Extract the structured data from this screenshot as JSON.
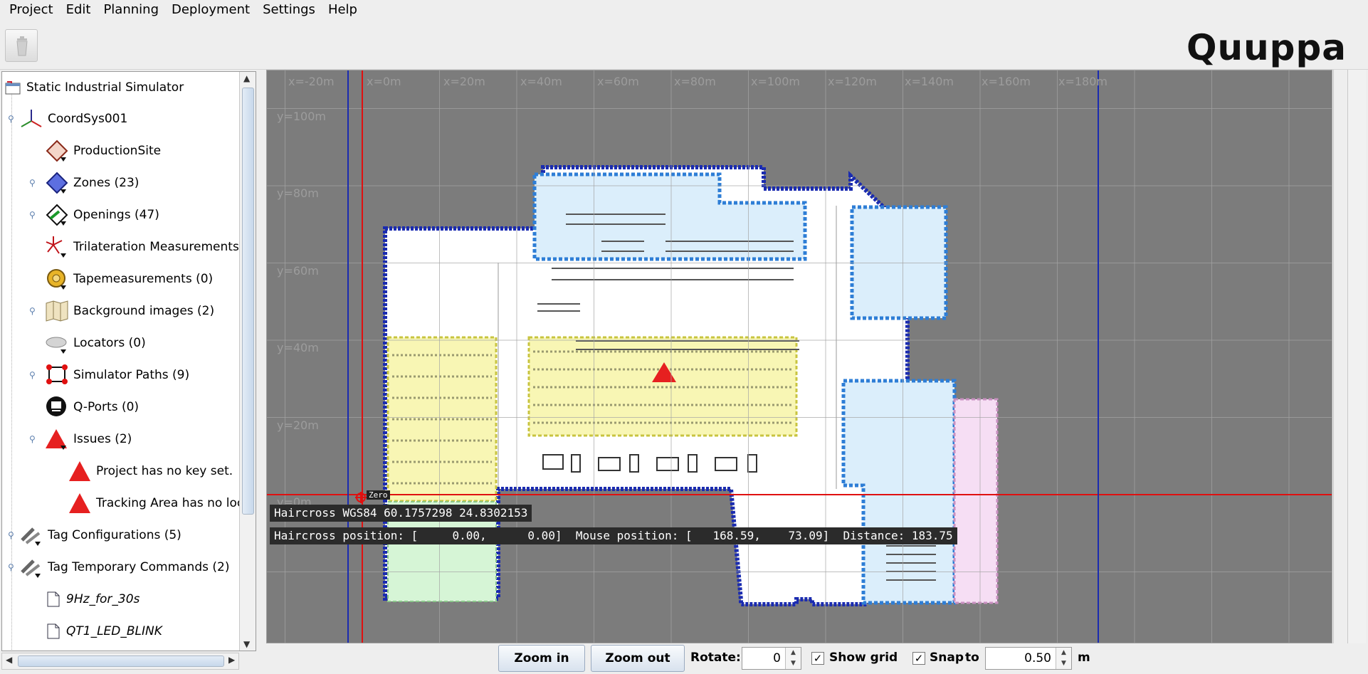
{
  "menu": [
    "Project",
    "Edit",
    "Planning",
    "Deployment",
    "Settings",
    "Help"
  ],
  "menu_mnemonics": [
    "P",
    "E",
    "l",
    "D",
    "S",
    "H"
  ],
  "logo": "Quuppa",
  "tree": {
    "root": "Static Industrial Simulator",
    "items": [
      {
        "label": "CoordSys001"
      },
      {
        "label": "ProductionSite"
      },
      {
        "label": "Zones (23)"
      },
      {
        "label": "Openings (47)"
      },
      {
        "label": "Trilateration Measurements ("
      },
      {
        "label": "Tapemeasurements (0)"
      },
      {
        "label": "Background images (2)"
      },
      {
        "label": "Locators (0)"
      },
      {
        "label": "Simulator Paths (9)"
      },
      {
        "label": "Q-Ports (0)"
      },
      {
        "label": "Issues (2)"
      },
      {
        "label": "Project has no key set."
      },
      {
        "label": "Tracking Area has no loc"
      },
      {
        "label": "Tag Configurations (5)"
      },
      {
        "label": "Tag Temporary Commands (2)"
      },
      {
        "label": "9Hz_for_30s"
      },
      {
        "label": "QT1_LED_BLINK"
      }
    ]
  },
  "map": {
    "x_labels": [
      "x=-20m",
      "x=0m",
      "x=20m",
      "x=40m",
      "x=60m",
      "x=80m",
      "x=100m",
      "x=120m",
      "x=140m",
      "x=160m",
      "x=180m"
    ],
    "y_labels": [
      "y=100m",
      "y=80m",
      "y=60m",
      "y=40m",
      "y=20m",
      "y=0m"
    ],
    "zero_label": "Zero",
    "status": {
      "wgs84": "Haircross WGS84 60.1757298 24.8302153",
      "positions": "Haircross position: [     0.00,      0.00]  Mouse position: [   168.59,    73.09]  Distance: 183.75"
    }
  },
  "bottom": {
    "zoom_in": "Zoom in",
    "zoom_out": "Zoom out",
    "rotate_label": "Rotate:",
    "rotate_value": "0",
    "show_grid_label": "Show grid",
    "show_grid_checked": "✓",
    "snap_label": "Snap",
    "snap_checked": "✓",
    "to_label": "to",
    "snap_value": "0.50",
    "unit": "m"
  },
  "colors": {
    "map_bg": "#7c7c7c",
    "floor": "#ffffff",
    "zone_blue": "#dbeefb",
    "zone_yellow": "#f8f6b4",
    "zone_green": "#d6f5d6",
    "zone_pink": "#f6def4",
    "wall": "#1a2bb0",
    "axis_red": "#e01010"
  }
}
